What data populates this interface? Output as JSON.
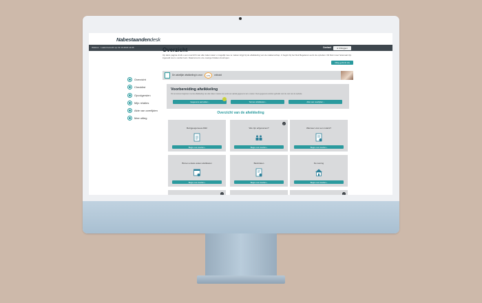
{
  "header": {
    "logo_bold": "Nabestaanden",
    "logo_light": "desk",
    "welcome": "Welkom · Laatst bezocht op 19-10-2023 14:05",
    "contact_label": "Contact",
    "logout_label": "Uitloggen"
  },
  "sidebar": {
    "items": [
      {
        "label": "Overzicht"
      },
      {
        "label": "Checklist"
      },
      {
        "label": "Opvolgersien"
      },
      {
        "label": "Mijn relaties"
      },
      {
        "label": "Akte van overlijden"
      },
      {
        "label": "Mee uitleg"
      }
    ]
  },
  "main": {
    "title": "Overzicht",
    "intro": "Op deze pagina vindt u een overzicht van alle zaken waar u mogelijk mee te maken krijgt bij de afwikkeling van de nalatenschap. U begint bij het blok Begeleren eerst de opzetten. Dit blok moet helemaal zijn ingevuld voor u verder kunt. Daarna kunt u de overige blokken doorlopen.",
    "help_button": "Uitleg gebruik site",
    "progress": {
      "label": "De zakelijke afwikkeling is voor",
      "percent": "17%",
      "done": "voltooid"
    },
    "prep": {
      "title": "Voorbereiding afwikkeling",
      "text": "Om te kunnen beginnen met de afwikkeling van alle zaken moeten we eerst een aantal gegevens van u weten. Deze gegevens worden gebruikt voor de rest van de website.",
      "buttons": [
        "Gegevens aanvullen",
        "Termen afwikkelen",
        "Akte van overlijden"
      ]
    },
    "section_title": "Overzicht van de afwikkeling",
    "cards": [
      {
        "label": "Bezigjeugemeea 2022",
        "button": "Begin met invullen",
        "icon": "document-icon",
        "check": false
      },
      {
        "label": "Wie zijn erfgenamen?",
        "button": "Begin met invullen",
        "icon": "people-icon",
        "check": true
      },
      {
        "label": "Wanneer voor een notaris?",
        "button": "Begin met invullen",
        "icon": "document-alert-icon",
        "check": false
      },
      {
        "label": "Binnen enkele weken afwikkelen",
        "button": "Begin met invullen",
        "icon": "calendar-icon",
        "check": false
      },
      {
        "label": "Bankzaken",
        "button": "Begin met invullen",
        "icon": "bank-document-icon",
        "check": false
      },
      {
        "label": "De woning",
        "button": "Begin met invullen",
        "icon": "house-icon",
        "check": false
      }
    ],
    "arrow_glyph": "›"
  }
}
